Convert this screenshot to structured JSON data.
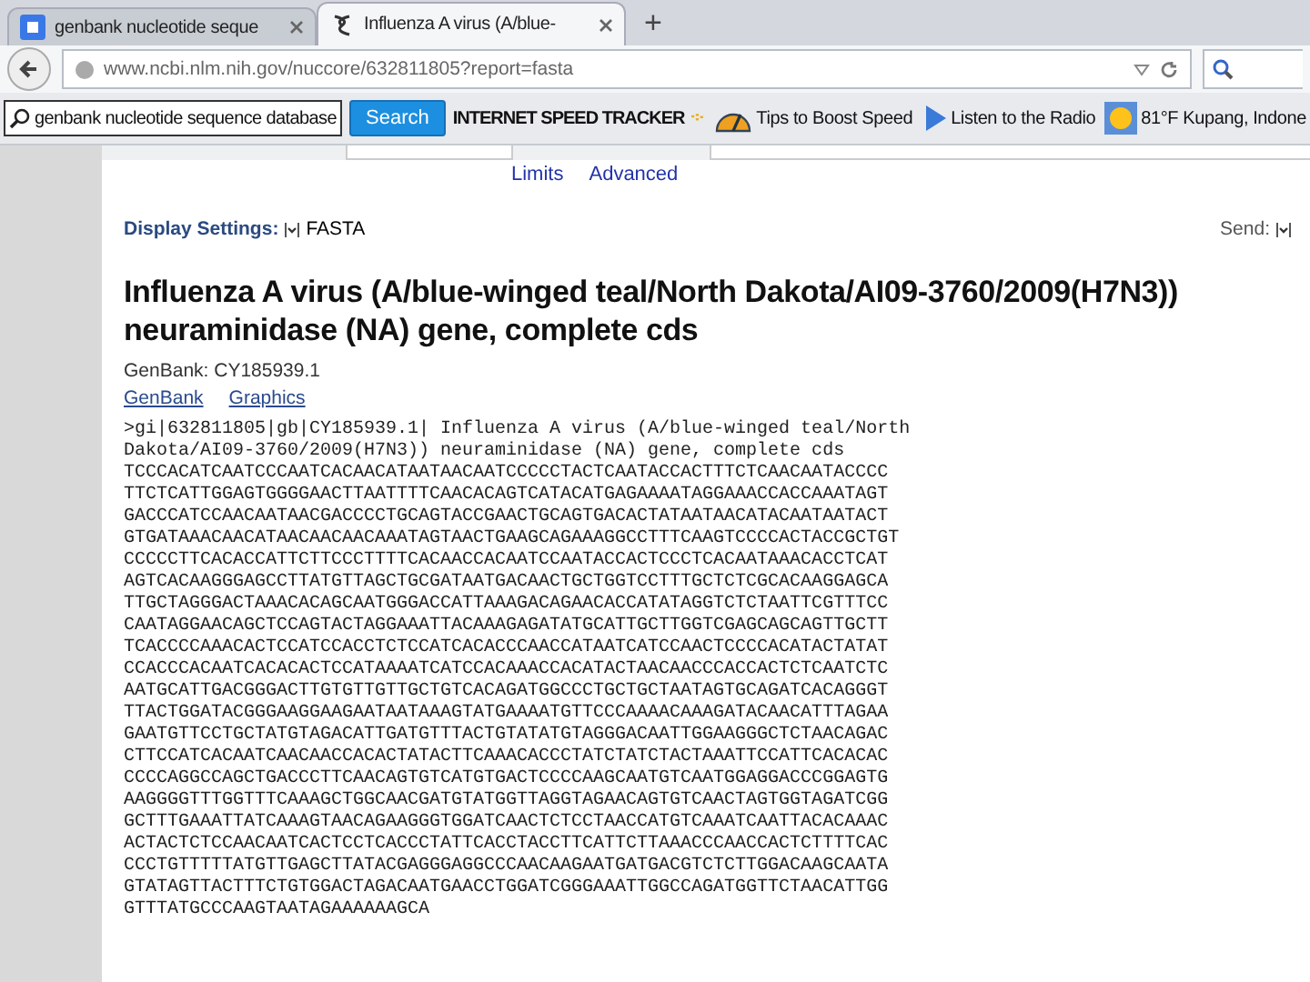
{
  "tabs": [
    {
      "label": "genbank nucleotide seque",
      "selected": false
    },
    {
      "label": "Influenza A virus (A/blue-",
      "selected": true
    }
  ],
  "new_tab": "+",
  "address": "www.ncbi.nlm.nih.gov/nuccore/632811805?report=fasta",
  "toolbar": {
    "search_value": "genbank nucleotide sequence database",
    "search_button": "Search",
    "brand": "INTERNET SPEED TRACKER",
    "items": [
      "Tips to Boost Speed",
      "Listen to the Radio",
      "81°F Kupang, Indone"
    ]
  },
  "search_links": [
    "Limits",
    "Advanced"
  ],
  "display_settings": {
    "label": "Display Settings:",
    "value": "FASTA"
  },
  "send": "Send:",
  "title": "Influenza A virus (A/blue-winged teal/North Dakota/AI09-3760/2009(H7N3)) neuraminidase (NA) gene, complete cds",
  "accession": "GenBank: CY185939.1",
  "record_links": [
    "GenBank",
    "Graphics"
  ],
  "fasta_lines": [
    ">gi|632811805|gb|CY185939.1| Influenza A virus (A/blue-winged teal/North",
    "Dakota/AI09-3760/2009(H7N3)) neuraminidase (NA) gene, complete cds",
    "TCCCACATCAATCCCAATCACAACATAATAACAATCCCCCTACTCAATACCACTTTCTCAACAATACCCC",
    "TTCTCATTGGAGTGGGGAACTTAATTTTCAACACAGTCATACATGAGAAAATAGGAAACCACCAAATAGT",
    "GACCCATCCAACAATAACGACCCCTGCAGTACCGAACTGCAGTGACACTATAATAACATACAATAATACT",
    "GTGATAAACAACATAACAACAACAAATAGTAACTGAAGCAGAAAGGCCTTTCAAGTCCCCACTACCGCTGT",
    "CCCCCTTCACACCATTCTTCCCTTTTCACAACCACAATCCAATACCACTCCCTCACAATAAACACCTCAT",
    "AGTCACAAGGGAGCCTTATGTTAGCTGCGATAATGACAACTGCTGGTCCTTTGCTCTCGCACAAGGAGCA",
    "TTGCTAGGGACTAAACACAGCAATGGGACCATTAAAGACAGAACACCATATAGGTCTCTAATTCGTTTCC",
    "CAATAGGAACAGCTCCAGTACTAGGAAATTACAAAGAGATATGCATTGCTTGGTCGAGCAGCAGTTGCTT",
    "TCACCCCAAACACTCCATCCACCTCTCCATCACACCCAACCATAATCATCCAACTCCCCACATACTATAT",
    "CCACCCACAATCACACACTCCATAAAATCATCCACAAACCACATACTAACAACCCACCACTCTCAATCTC",
    "AATGCATTGACGGGACTTGTGTTGTTGCTGTCACAGATGGCCCTGCTGCTAATAGTGCAGATCACAGGGT",
    "TTACTGGATACGGGAAGGAAGAATAATAAAGTATGAAAATGTTCCCAAAACAAAGATACAACATTTAGAA",
    "GAATGTTCCTGCTATGTAGACATTGATGTTTACTGTATATGTAGGGACAATTGGAAGGGCTCTAACAGAC",
    "CTTCCATCACAATCAACAACCACACTATACTTCAAACACCCTATCTATCTACTAAATTCCATTCACACAC",
    "CCCCAGGCCAGCTGACCCTTCAACAGTGTCATGTGACTCCCCAAGCAATGTCAATGGAGGACCCGGAGTG",
    "AAGGGGTTTGGTTTCAAAGCTGGCAACGATGTATGGTTAGGTAGAACAGTGTCAACTAGTGGTAGATCGG",
    "GCTTTGAAATTATCAAAGTAACAGAAGGGTGGATCAACTCTCCTAACCATGTCAAATCAATTACACAAAC",
    "ACTACTCTCCAACAATCACTCCTCACCCTATTCACCTACCTTCATTCTTAAACCCAACCACTCTTTTCAC",
    "CCCTGTTTTTATGTTGAGCTTATACGAGGGAGGCCCAACAAGAATGATGACGTCTCTTGGACAAGCAATA",
    "GTATAGTTACTTTCTGTGGACTAGACAATGAACCTGGATCGGGAAATTGGCCAGATGGTTCTAACATTGG",
    "GTTTATGCCCAAGTAATAGAAAAAAGCA"
  ]
}
